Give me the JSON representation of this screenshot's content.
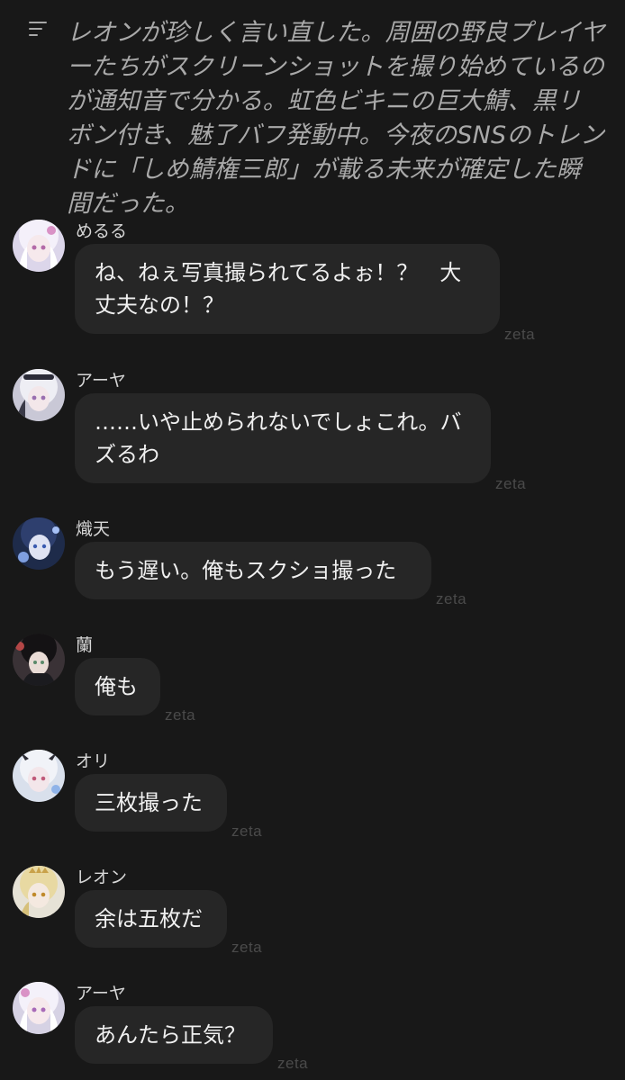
{
  "narration": {
    "text": "レオンが珍しく言い直した。周囲の野良プレイヤーたちがスクリーンショットを撮り始めているのが通知音で分かる。虹色ビキニの巨大鯖、黒リボン付き、魅了バフ発動中。今夜のSNSのトレンドに「しめ鯖権三郎」が載る未来が確定した瞬間だった。"
  },
  "watermark": "zeta",
  "messages": [
    {
      "speaker": "めるる",
      "text": "ね、ねぇ写真撮られてるよぉ！？　大丈夫なの！？",
      "avatar": "white-haired-girl-avatar"
    },
    {
      "speaker": "アーヤ",
      "text": "……いや止められないでしょこれ。バズるわ",
      "avatar": "white-haired-maid-avatar"
    },
    {
      "speaker": "熾天",
      "text": "もう遅い。俺もスクショ撮った",
      "avatar": "dark-haired-boy-avatar"
    },
    {
      "speaker": "蘭",
      "text": "俺も",
      "avatar": "black-haired-man-avatar"
    },
    {
      "speaker": "オリ",
      "text": "三枚撮った",
      "avatar": "horned-girl-avatar"
    },
    {
      "speaker": "レオン",
      "text": "余は五枚だ",
      "avatar": "blonde-king-avatar"
    },
    {
      "speaker": "アーヤ",
      "text": "あんたら正気？",
      "avatar": "white-haired-maid-avatar"
    }
  ]
}
